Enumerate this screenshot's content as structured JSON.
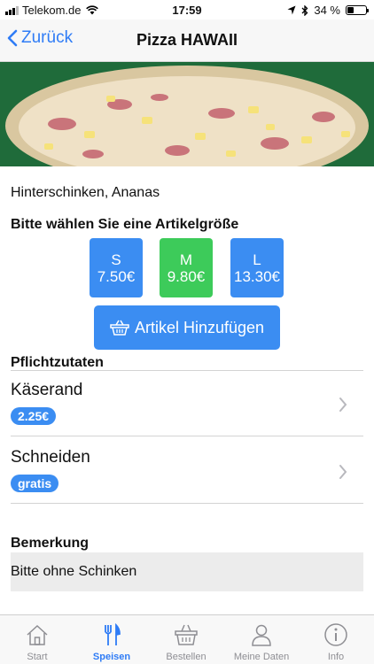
{
  "status_bar": {
    "carrier": "Telekom.de",
    "time": "17:59",
    "battery": "34 %",
    "battery_level": 0.34
  },
  "nav": {
    "back_label": "Zurück",
    "title": "Pizza HAWAII"
  },
  "product": {
    "description": "Hinterschinken, Ananas",
    "size_heading": "Bitte wählen Sie eine Artikelgröße",
    "sizes": [
      {
        "label": "S",
        "price": "7.50€",
        "selected": false
      },
      {
        "label": "M",
        "price": "9.80€",
        "selected": true
      },
      {
        "label": "L",
        "price": "13.30€",
        "selected": false
      }
    ],
    "add_button": "Artikel Hinzufügen"
  },
  "required": {
    "title": "Pflichtzutaten",
    "items": [
      {
        "label": "Käserand",
        "badge": "2.25€"
      },
      {
        "label": "Schneiden",
        "badge": "gratis"
      }
    ]
  },
  "remark": {
    "title": "Bemerkung",
    "value": "Bitte ohne Schinken"
  },
  "tabs": [
    {
      "label": "Start",
      "icon": "home-icon",
      "active": false
    },
    {
      "label": "Speisen",
      "icon": "cutlery-icon",
      "active": true
    },
    {
      "label": "Bestellen",
      "icon": "basket-icon",
      "active": false
    },
    {
      "label": "Meine Daten",
      "icon": "person-icon",
      "active": false
    },
    {
      "label": "Info",
      "icon": "info-icon",
      "active": false
    }
  ],
  "colors": {
    "accent": "#2f7cf6",
    "size_button": "#3b8df2",
    "size_selected": "#3dcb5a",
    "hero_bg": "#1f6b3a"
  }
}
